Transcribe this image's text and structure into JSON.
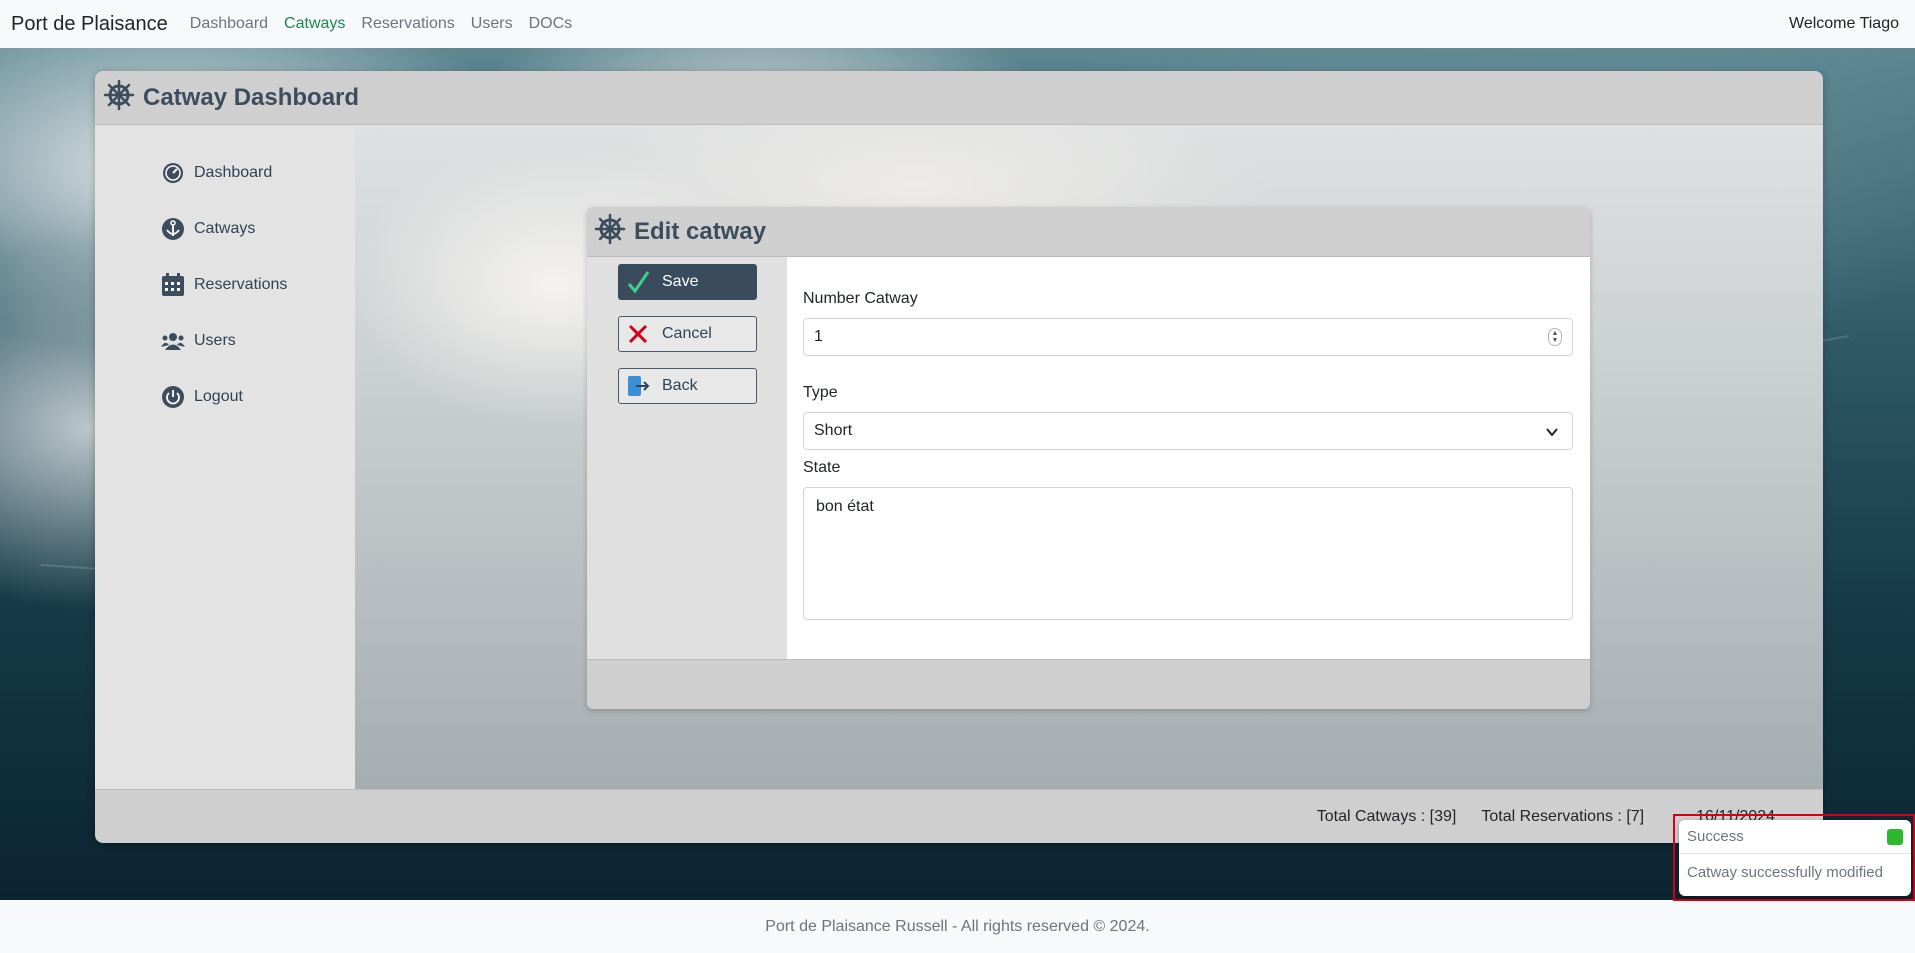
{
  "navbar": {
    "brand": "Port de Plaisance",
    "links": [
      "Dashboard",
      "Catways",
      "Reservations",
      "Users",
      "DOCs"
    ],
    "active": "Catways",
    "welcome": "Welcome Tiago"
  },
  "dashboard": {
    "title": "Catway Dashboard",
    "sidebar": [
      {
        "label": "Dashboard",
        "icon": "dashboard-gauge-icon"
      },
      {
        "label": "Catways",
        "icon": "anchor-icon"
      },
      {
        "label": "Reservations",
        "icon": "calendar-icon"
      },
      {
        "label": "Users",
        "icon": "users-icon"
      },
      {
        "label": "Logout",
        "icon": "power-icon"
      }
    ],
    "footer": {
      "total_catways": "Total Catways : [39]",
      "total_reservations": "Total Reservations : [7]",
      "date": "16/11/2024"
    }
  },
  "edit": {
    "title": "Edit catway",
    "buttons": {
      "save": "Save",
      "cancel": "Cancel",
      "back": "Back"
    },
    "form": {
      "number_label": "Number Catway",
      "number_value": "1",
      "type_label": "Type",
      "type_value": "Short",
      "state_label": "State",
      "state_value": "bon état"
    }
  },
  "toast": {
    "title": "Success",
    "message": "Catway successfully modified",
    "status_color": "#2eb82e"
  },
  "site_footer": "Port de Plaisance Russell - All rights reserved © 2024.",
  "colors": {
    "accent": "#3b4b5e",
    "active_link": "#198754",
    "highlight": "#d0021b"
  }
}
